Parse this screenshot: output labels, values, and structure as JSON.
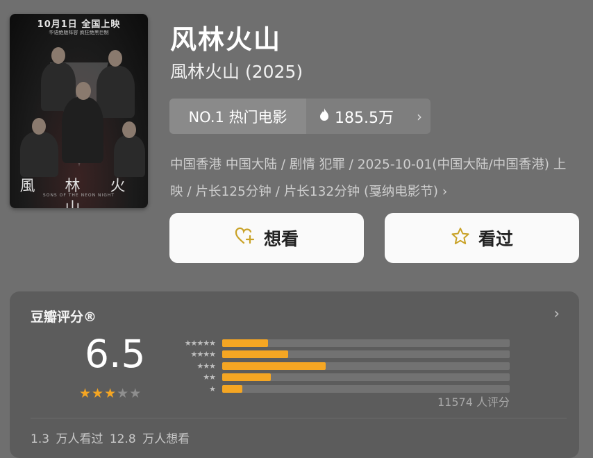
{
  "poster": {
    "release_line": "10月1日 全国上映",
    "tagline": "华语绝版阵容  疯狂绝黑巨制",
    "title_text": "風 林 火 山",
    "en_title": "SONS OF THE NEON NIGHT"
  },
  "movie": {
    "title": "风林火山",
    "subtitle": "風林火山 (2025)"
  },
  "rank": {
    "label": "NO.1 热门电影",
    "heat_icon": "flame-icon",
    "heat": "185.5万",
    "chevron": "›"
  },
  "meta": {
    "text": "中国香港 中国大陆 / 剧情 犯罪 / 2025-10-01(中国大陆/中国香港) 上映 / 片长125分钟 / 片长132分钟 (戛纳电影节)",
    "chevron": "›"
  },
  "actions": {
    "want_label": "想看",
    "want_icon": "heart-plus-icon",
    "seen_label": "看过",
    "seen_icon": "star-outline-icon"
  },
  "rating": {
    "label": "豆瓣评分®",
    "score": "6.5",
    "stars_on": 3,
    "stars_total": 5,
    "distribution": [
      {
        "stars": "★★★★★",
        "percent": 16
      },
      {
        "stars": "★★★★",
        "percent": 23
      },
      {
        "stars": "★★★",
        "percent": 36
      },
      {
        "stars": "★★",
        "percent": 17
      },
      {
        "stars": "★",
        "percent": 7
      }
    ],
    "count": "11574 人评分",
    "chevron": "›",
    "footer": "1.3 万人看过  12.8 万人想看",
    "accent": "#f5a623"
  }
}
